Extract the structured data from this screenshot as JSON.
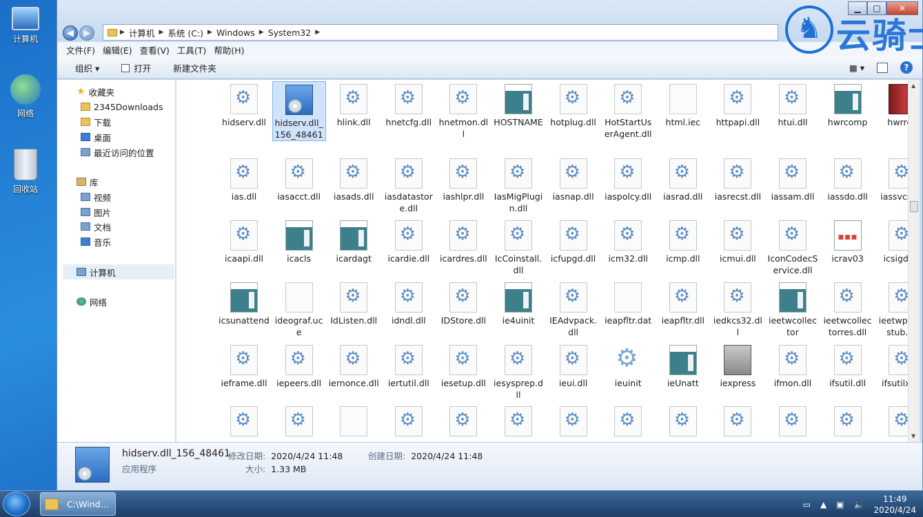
{
  "desktop": {
    "icons": [
      "计算机",
      "网络",
      "回收站"
    ]
  },
  "window": {
    "address": [
      "计算机",
      "系统 (C:)",
      "Windows",
      "System32"
    ],
    "menu": [
      "文件(F)",
      "编辑(E)",
      "查看(V)",
      "工具(T)",
      "帮助(H)"
    ],
    "toolbar": {
      "organize": "组织 ▾",
      "open": "打开",
      "new_folder": "新建文件夹"
    },
    "sidebar": {
      "favorites": "收藏夹",
      "fav_items": [
        "2345Downloads",
        "下载",
        "桌面",
        "最近访问的位置"
      ],
      "libraries": "库",
      "lib_items": [
        "视频",
        "图片",
        "文档",
        "音乐"
      ],
      "computer": "计算机",
      "network": "网络"
    },
    "files": [
      {
        "name": "hidserv.dll",
        "icon": "dll"
      },
      {
        "name": "hidserv.dll_156_48461",
        "icon": "setup",
        "selected": true
      },
      {
        "name": "hlink.dll",
        "icon": "dll"
      },
      {
        "name": "hnetcfg.dll",
        "icon": "dll"
      },
      {
        "name": "hnetmon.dll",
        "icon": "dll"
      },
      {
        "name": "HOSTNAME",
        "icon": "exe"
      },
      {
        "name": "hotplug.dll",
        "icon": "dll"
      },
      {
        "name": "HotStartUserAgent.dll",
        "icon": "dll"
      },
      {
        "name": "html.iec",
        "icon": "blank"
      },
      {
        "name": "httpapi.dll",
        "icon": "dll"
      },
      {
        "name": "htui.dll",
        "icon": "dll"
      },
      {
        "name": "hwrcomp",
        "icon": "exe"
      },
      {
        "name": "hwrreg",
        "icon": "red"
      },
      {
        "name": "ias.dll",
        "icon": "dll"
      },
      {
        "name": "iasacct.dll",
        "icon": "dll"
      },
      {
        "name": "iasads.dll",
        "icon": "dll"
      },
      {
        "name": "iasdatastore.dll",
        "icon": "dll"
      },
      {
        "name": "iashlpr.dll",
        "icon": "dll"
      },
      {
        "name": "IasMigPlugin.dll",
        "icon": "dll"
      },
      {
        "name": "iasnap.dll",
        "icon": "dll"
      },
      {
        "name": "iaspolcy.dll",
        "icon": "dll"
      },
      {
        "name": "iasrad.dll",
        "icon": "dll"
      },
      {
        "name": "iasrecst.dll",
        "icon": "dll"
      },
      {
        "name": "iassam.dll",
        "icon": "dll"
      },
      {
        "name": "iassdo.dll",
        "icon": "dll"
      },
      {
        "name": "iassvcs.dll",
        "icon": "dll"
      },
      {
        "name": "icaapi.dll",
        "icon": "dll"
      },
      {
        "name": "icacls",
        "icon": "exe"
      },
      {
        "name": "icardagt",
        "icon": "exe"
      },
      {
        "name": "icardie.dll",
        "icon": "dll"
      },
      {
        "name": "icardres.dll",
        "icon": "dll"
      },
      {
        "name": "IcCoinstall.dll",
        "icon": "dll"
      },
      {
        "name": "icfupgd.dll",
        "icon": "dll"
      },
      {
        "name": "icm32.dll",
        "icon": "dll"
      },
      {
        "name": "icmp.dll",
        "icon": "dll"
      },
      {
        "name": "icmui.dll",
        "icon": "dll"
      },
      {
        "name": "IconCodecService.dll",
        "icon": "dll"
      },
      {
        "name": "icrav03",
        "icon": "icon"
      },
      {
        "name": "icsigd.dll",
        "icon": "dll"
      },
      {
        "name": "icsunattend",
        "icon": "exe"
      },
      {
        "name": "ideograf.uce",
        "icon": "blank"
      },
      {
        "name": "IdListen.dll",
        "icon": "dll"
      },
      {
        "name": "idndl.dll",
        "icon": "dll"
      },
      {
        "name": "IDStore.dll",
        "icon": "dll"
      },
      {
        "name": "ie4uinit",
        "icon": "exe"
      },
      {
        "name": "IEAdvpack.dll",
        "icon": "dll"
      },
      {
        "name": "ieapfltr.dat",
        "icon": "blank"
      },
      {
        "name": "ieapfltr.dll",
        "icon": "dll"
      },
      {
        "name": "iedkcs32.dll",
        "icon": "dll"
      },
      {
        "name": "ieetwcollector",
        "icon": "exe"
      },
      {
        "name": "ieetwcollectorres.dll",
        "icon": "dll"
      },
      {
        "name": "ieetwproxystub.dll",
        "icon": "dll"
      },
      {
        "name": "ieframe.dll",
        "icon": "dll"
      },
      {
        "name": "iepeers.dll",
        "icon": "dll"
      },
      {
        "name": "iernonce.dll",
        "icon": "dll"
      },
      {
        "name": "iertutil.dll",
        "icon": "dll"
      },
      {
        "name": "iesetup.dll",
        "icon": "dll"
      },
      {
        "name": "iesysprep.dll",
        "icon": "dll"
      },
      {
        "name": "ieui.dll",
        "icon": "dll"
      },
      {
        "name": "ieuinit",
        "icon": "gear"
      },
      {
        "name": "ieUnatt",
        "icon": "exe"
      },
      {
        "name": "iexpress",
        "icon": "cab"
      },
      {
        "name": "ifmon.dll",
        "icon": "dll"
      },
      {
        "name": "ifsutil.dll",
        "icon": "dll"
      },
      {
        "name": "ifsutilx.dll",
        "icon": "dll"
      }
    ],
    "partial_row_icons": [
      "dll",
      "dll",
      "blank",
      "dll",
      "dll",
      "dll",
      "dll",
      "dll",
      "dll",
      "dll",
      "dll",
      "dll",
      "dll"
    ],
    "details": {
      "name": "hidserv.dll_156_48461",
      "type": "应用程序",
      "modified_label": "修改日期:",
      "modified": "2020/4/24 11:48",
      "created_label": "创建日期:",
      "created": "2020/4/24 11:48",
      "size_label": "大小:",
      "size": "1.33 MB"
    }
  },
  "taskbar": {
    "task": "C:\\Wind...",
    "time": "11:49",
    "date": "2020/4/24"
  },
  "watermark": "云骑士",
  "colors": {
    "accent": "#1d6fd6",
    "selection": "#cfe3fb"
  }
}
